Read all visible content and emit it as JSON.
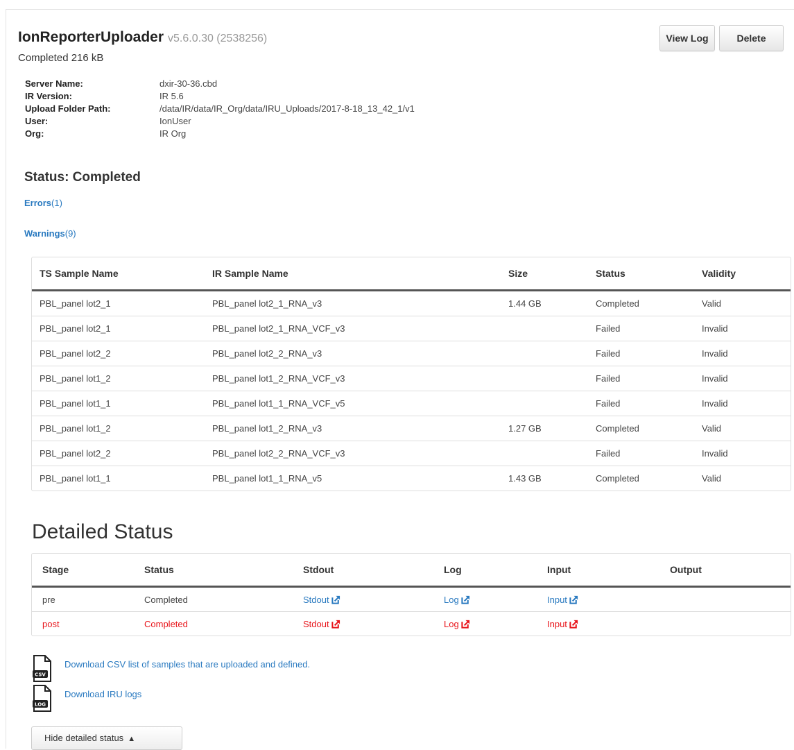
{
  "header": {
    "title": "IonReporterUploader",
    "version": "v5.6.0.30 (2538256)",
    "subtitle": "Completed 216 kB",
    "view_log_label": "View Log",
    "delete_label": "Delete"
  },
  "info": [
    {
      "label": "Server Name:",
      "value": "dxir-30-36.cbd"
    },
    {
      "label": "IR Version:",
      "value": "IR 5.6"
    },
    {
      "label": "Upload Folder Path:",
      "value": "/data/IR/data/IR_Org/data/IRU_Uploads/2017-8-18_13_42_1/v1"
    },
    {
      "label": "User:",
      "value": "IonUser"
    },
    {
      "label": "Org:",
      "value": "IR Org"
    }
  ],
  "status": {
    "heading": "Status: Completed",
    "errors_label": "Errors",
    "errors_count": "(1)",
    "warnings_label": "Warnings",
    "warnings_count": "(9)"
  },
  "samples_table": {
    "headers": [
      "TS Sample Name",
      "IR Sample Name",
      "Size",
      "Status",
      "Validity"
    ],
    "rows": [
      [
        "PBL_panel lot2_1",
        "PBL_panel lot2_1_RNA_v3",
        "1.44 GB",
        "Completed",
        "Valid"
      ],
      [
        "PBL_panel lot2_1",
        "PBL_panel lot2_1_RNA_VCF_v3",
        "",
        "Failed",
        "Invalid"
      ],
      [
        "PBL_panel lot2_2",
        "PBL_panel lot2_2_RNA_v3",
        "",
        "Failed",
        "Invalid"
      ],
      [
        "PBL_panel lot1_2",
        "PBL_panel lot1_2_RNA_VCF_v3",
        "",
        "Failed",
        "Invalid"
      ],
      [
        "PBL_panel lot1_1",
        "PBL_panel lot1_1_RNA_VCF_v5",
        "",
        "Failed",
        "Invalid"
      ],
      [
        "PBL_panel lot1_2",
        "PBL_panel lot1_2_RNA_v3",
        "1.27 GB",
        "Completed",
        "Valid"
      ],
      [
        "PBL_panel lot2_2",
        "PBL_panel lot2_2_RNA_VCF_v3",
        "",
        "Failed",
        "Invalid"
      ],
      [
        "PBL_panel lot1_1",
        "PBL_panel lot1_1_RNA_v5",
        "1.43 GB",
        "Completed",
        "Valid"
      ]
    ]
  },
  "detailed": {
    "title": "Detailed Status",
    "headers": [
      "Stage",
      "Status",
      "Stdout",
      "Log",
      "Input",
      "Output"
    ],
    "rows": [
      [
        "pre",
        "Completed",
        "Stdout",
        "Log",
        "Input",
        ""
      ],
      [
        "post",
        "Completed",
        "Stdout",
        "Log",
        "Input",
        ""
      ]
    ]
  },
  "downloads": {
    "csv_icon_text": "CSV",
    "csv_label": "Download CSV list of samples that are uploaded and defined.",
    "log_icon_text": "LOG",
    "log_label": "Download IRU logs"
  },
  "hide_button_label": "Hide detailed status",
  "colors": {
    "link": "#2a7ac0",
    "error": "#e8141a"
  },
  "icons": {
    "external": "external-link-icon",
    "csv": "csv-file-icon",
    "log": "log-file-icon",
    "collapse": "triangle-up-icon"
  }
}
